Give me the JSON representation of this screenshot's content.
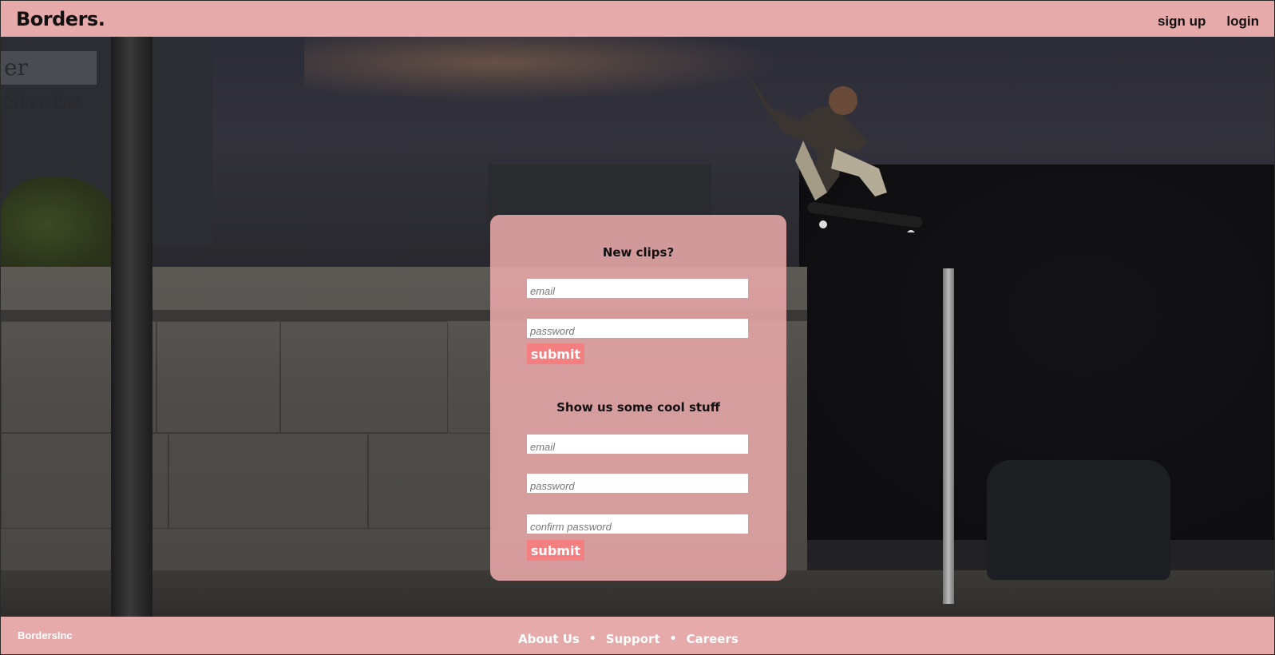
{
  "header": {
    "logo": "Borders.",
    "nav": [
      {
        "label": "sign up"
      },
      {
        "label": "login"
      }
    ]
  },
  "background": {
    "street_sign_text": "er Straße"
  },
  "login_form": {
    "title": "New clips?",
    "email_placeholder": "email",
    "password_placeholder": "password",
    "submit_label": "submit"
  },
  "signup_form": {
    "title": "Show us some cool stuff",
    "email_placeholder": "email",
    "password_placeholder": "password",
    "confirm_placeholder": "confirm password",
    "submit_label": "submit"
  },
  "footer": {
    "brand": "BordersInc",
    "links": [
      {
        "label": "About Us"
      },
      {
        "label": "Support"
      },
      {
        "label": "Careers"
      }
    ],
    "separator": "•"
  },
  "colors": {
    "bar_pink": "#e6aaaa",
    "card_pink": "#e9a8aa",
    "button_coral": "#f37f80"
  }
}
